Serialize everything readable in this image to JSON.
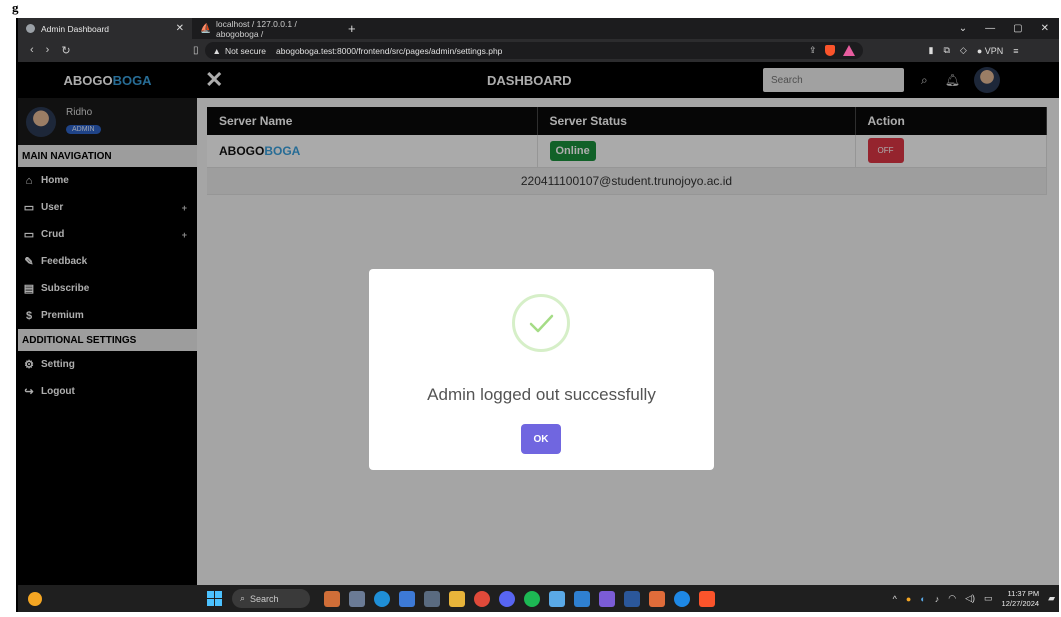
{
  "caption": "g",
  "browser": {
    "active_tab": "Admin Dashboard",
    "inactive_tab": "localhost / 127.0.0.1 / abogoboga /",
    "new_tab": "+",
    "not_secure": "Not secure",
    "url": "abogoboga.test:8000/frontend/src/pages/admin/settings.php",
    "vpn": "VPN"
  },
  "header": {
    "brand_part1": "ABOGO",
    "brand_part2": "BOGA",
    "title": "DASHBOARD",
    "search_placeholder": "Search"
  },
  "sidebar": {
    "user_name": "Ridho",
    "user_role": "ADMIN",
    "main_nav_label": "MAIN NAVIGATION",
    "main_items": [
      {
        "label": "Home",
        "icon": "home-icon"
      },
      {
        "label": "User",
        "icon": "folder-icon",
        "expand": "+"
      },
      {
        "label": "Crud",
        "icon": "folder-icon",
        "expand": "+"
      },
      {
        "label": "Feedback",
        "icon": "edit-icon"
      },
      {
        "label": "Subscribe",
        "icon": "card-icon"
      },
      {
        "label": "Premium",
        "icon": "dollar-icon"
      }
    ],
    "additional_label": "ADDITIONAL SETTINGS",
    "additional_items": [
      {
        "label": "Setting",
        "icon": "gear-icon"
      },
      {
        "label": "Logout",
        "icon": "logout-icon"
      }
    ]
  },
  "table": {
    "headers": [
      "Server Name",
      "Server Status",
      "Action"
    ],
    "row": {
      "name_part1": "ABOGO",
      "name_part2": "BOGA",
      "status": "Online",
      "action": "OFF"
    },
    "footer": "220411100107@student.trunojoyo.ac.id"
  },
  "modal": {
    "title": "Admin logged out successfully",
    "ok_label": "OK",
    "icon": "success-check-icon"
  },
  "taskbar": {
    "search": "Search",
    "time": "11:37 PM",
    "date": "12/27/2024"
  },
  "colors": {
    "brand_accent": "#3aa0dc",
    "online": "#1a8f3c",
    "off": "#dc3545",
    "ok_button": "#7066e0",
    "sidebar_bg": "#000000"
  }
}
